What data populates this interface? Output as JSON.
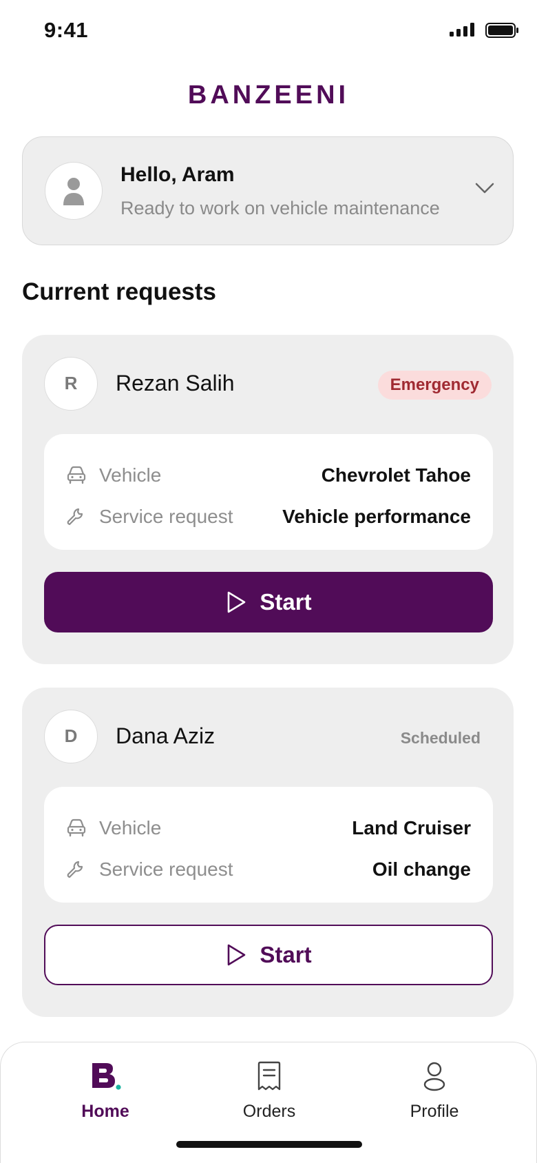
{
  "status_bar": {
    "time": "9:41",
    "signal_icon": "signal-icon",
    "battery_icon": "battery-icon"
  },
  "brand": {
    "name": "BANZEENI",
    "color": "#510c58"
  },
  "greeting": {
    "title": "Hello, Aram",
    "subtitle": "Ready to work on vehicle maintenance",
    "avatar_icon": "user-icon",
    "expand_icon": "chevron-down-icon"
  },
  "current_requests": {
    "heading": "Current requests",
    "items": [
      {
        "initial": "R",
        "name": "Rezan Salih",
        "badge": "Emergency",
        "vehicle_label": "Vehicle",
        "vehicle": "Chevrolet Tahoe",
        "service_label": "Service request",
        "service": "Vehicle performance",
        "action": "Start",
        "action_style": "filled"
      },
      {
        "initial": "D",
        "name": "Dana Aziz",
        "badge": "Scheduled",
        "vehicle_label": "Vehicle",
        "vehicle": "Land Cruiser",
        "service_label": "Service request",
        "service": "Oil change",
        "action": "Start",
        "action_style": "outline"
      }
    ]
  },
  "tab_bar": {
    "tabs": [
      {
        "label": "Home",
        "icon": "home-logo-icon",
        "active": true
      },
      {
        "label": "Orders",
        "icon": "receipt-icon",
        "active": false
      },
      {
        "label": "Profile",
        "icon": "person-icon",
        "active": false
      }
    ]
  },
  "colors": {
    "primary": "#510c58",
    "emergency_bg": "#fbdcdc",
    "emergency_text": "#a02a32",
    "accent_dot": "#1bb3a0",
    "card_bg": "#eeeeee"
  }
}
